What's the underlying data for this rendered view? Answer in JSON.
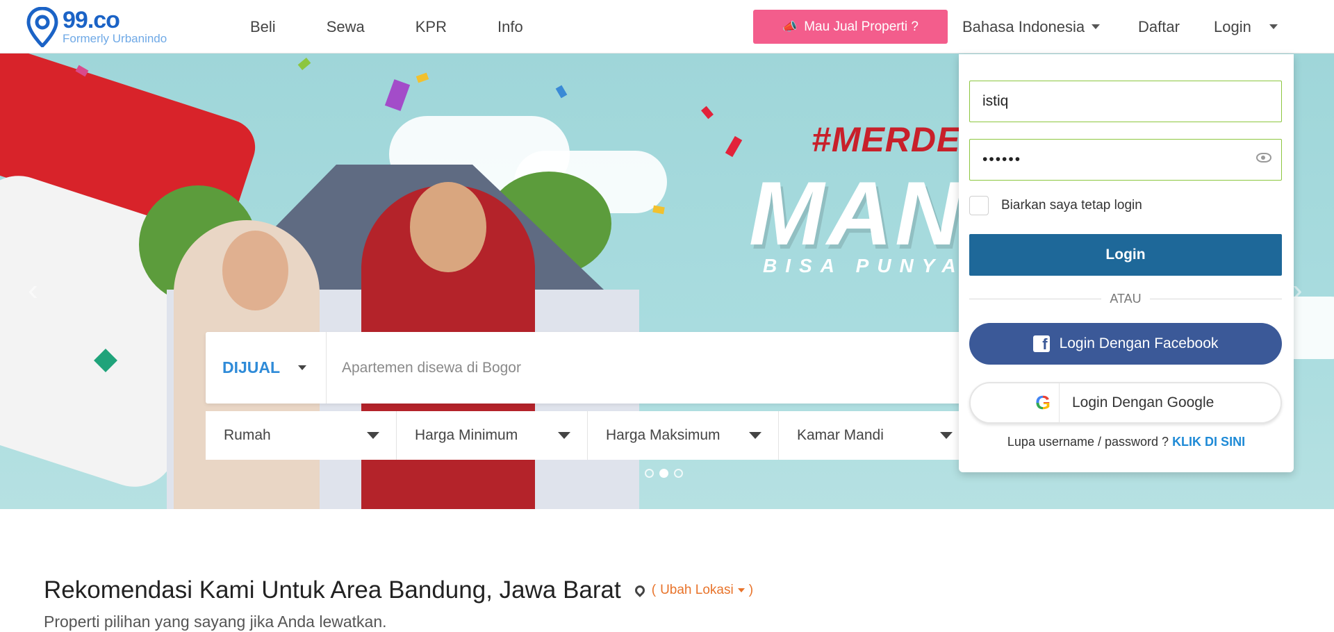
{
  "header": {
    "logo_name": "99.co",
    "logo_sub": "Formerly Urbanindo",
    "nav": [
      "Beli",
      "Sewa",
      "KPR",
      "Info"
    ],
    "sell_button": "Mau Jual Properti ?",
    "language": "Bahasa Indonesia",
    "register": "Daftar",
    "login": "Login"
  },
  "hero": {
    "headline": "#MERDEKA",
    "big_word": "MAN",
    "tagline": "BISA PUNYA",
    "slide_count": 3,
    "active_slide": 2
  },
  "search": {
    "listing_type": "DIJUAL",
    "placeholder": "Apartemen disewa di Bogor",
    "filters": [
      "Rumah",
      "Harga Minimum",
      "Harga Maksimum",
      "Kamar Mandi"
    ]
  },
  "login_panel": {
    "username_value": "istiq",
    "password_value": "••••••",
    "remember_label": "Biarkan saya tetap login",
    "login_button": "Login",
    "divider": "ATAU",
    "facebook_button": "Login Dengan Facebook",
    "google_button": "Login Dengan Google",
    "forgot_text": "Lupa username / password ?",
    "forgot_link": "KLIK DI SINI"
  },
  "recommendation": {
    "title": "Rekomendasi Kami Untuk Area Bandung, Jawa Barat",
    "change_location": "Ubah Lokasi",
    "subtitle": "Properti pilihan yang sayang jika Anda lewatkan."
  },
  "colors": {
    "brand_blue": "#1b63c6",
    "sell_pink": "#f35d8c",
    "login_blue": "#1e6899",
    "facebook": "#3b5998",
    "accent_orange": "#e8732a",
    "field_border": "#8cc63f"
  }
}
